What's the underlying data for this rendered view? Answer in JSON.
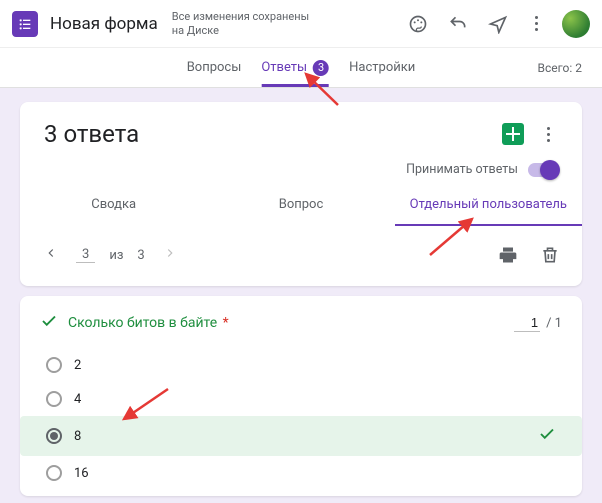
{
  "header": {
    "title": "Новая форма",
    "save_note": "Все изменения сохранены на Диске"
  },
  "tabs": {
    "items": [
      {
        "label": "Вопросы"
      },
      {
        "label": "Ответы",
        "badge": "3"
      },
      {
        "label": "Настройки"
      }
    ],
    "total_label": "Всего: 2"
  },
  "responses": {
    "title": "3 ответа",
    "accept_label": "Принимать ответы",
    "subtabs": [
      {
        "label": "Сводка"
      },
      {
        "label": "Вопрос"
      },
      {
        "label": "Отдельный пользователь"
      }
    ],
    "pager": {
      "current": "3",
      "of_label": "из",
      "total": "3"
    }
  },
  "question": {
    "title": "Сколько битов в байте",
    "score_value": "1",
    "score_max": "/ 1",
    "options": [
      {
        "label": "2",
        "selected": false
      },
      {
        "label": "4",
        "selected": false
      },
      {
        "label": "8",
        "selected": true,
        "correct": true
      },
      {
        "label": "16",
        "selected": false
      }
    ]
  }
}
